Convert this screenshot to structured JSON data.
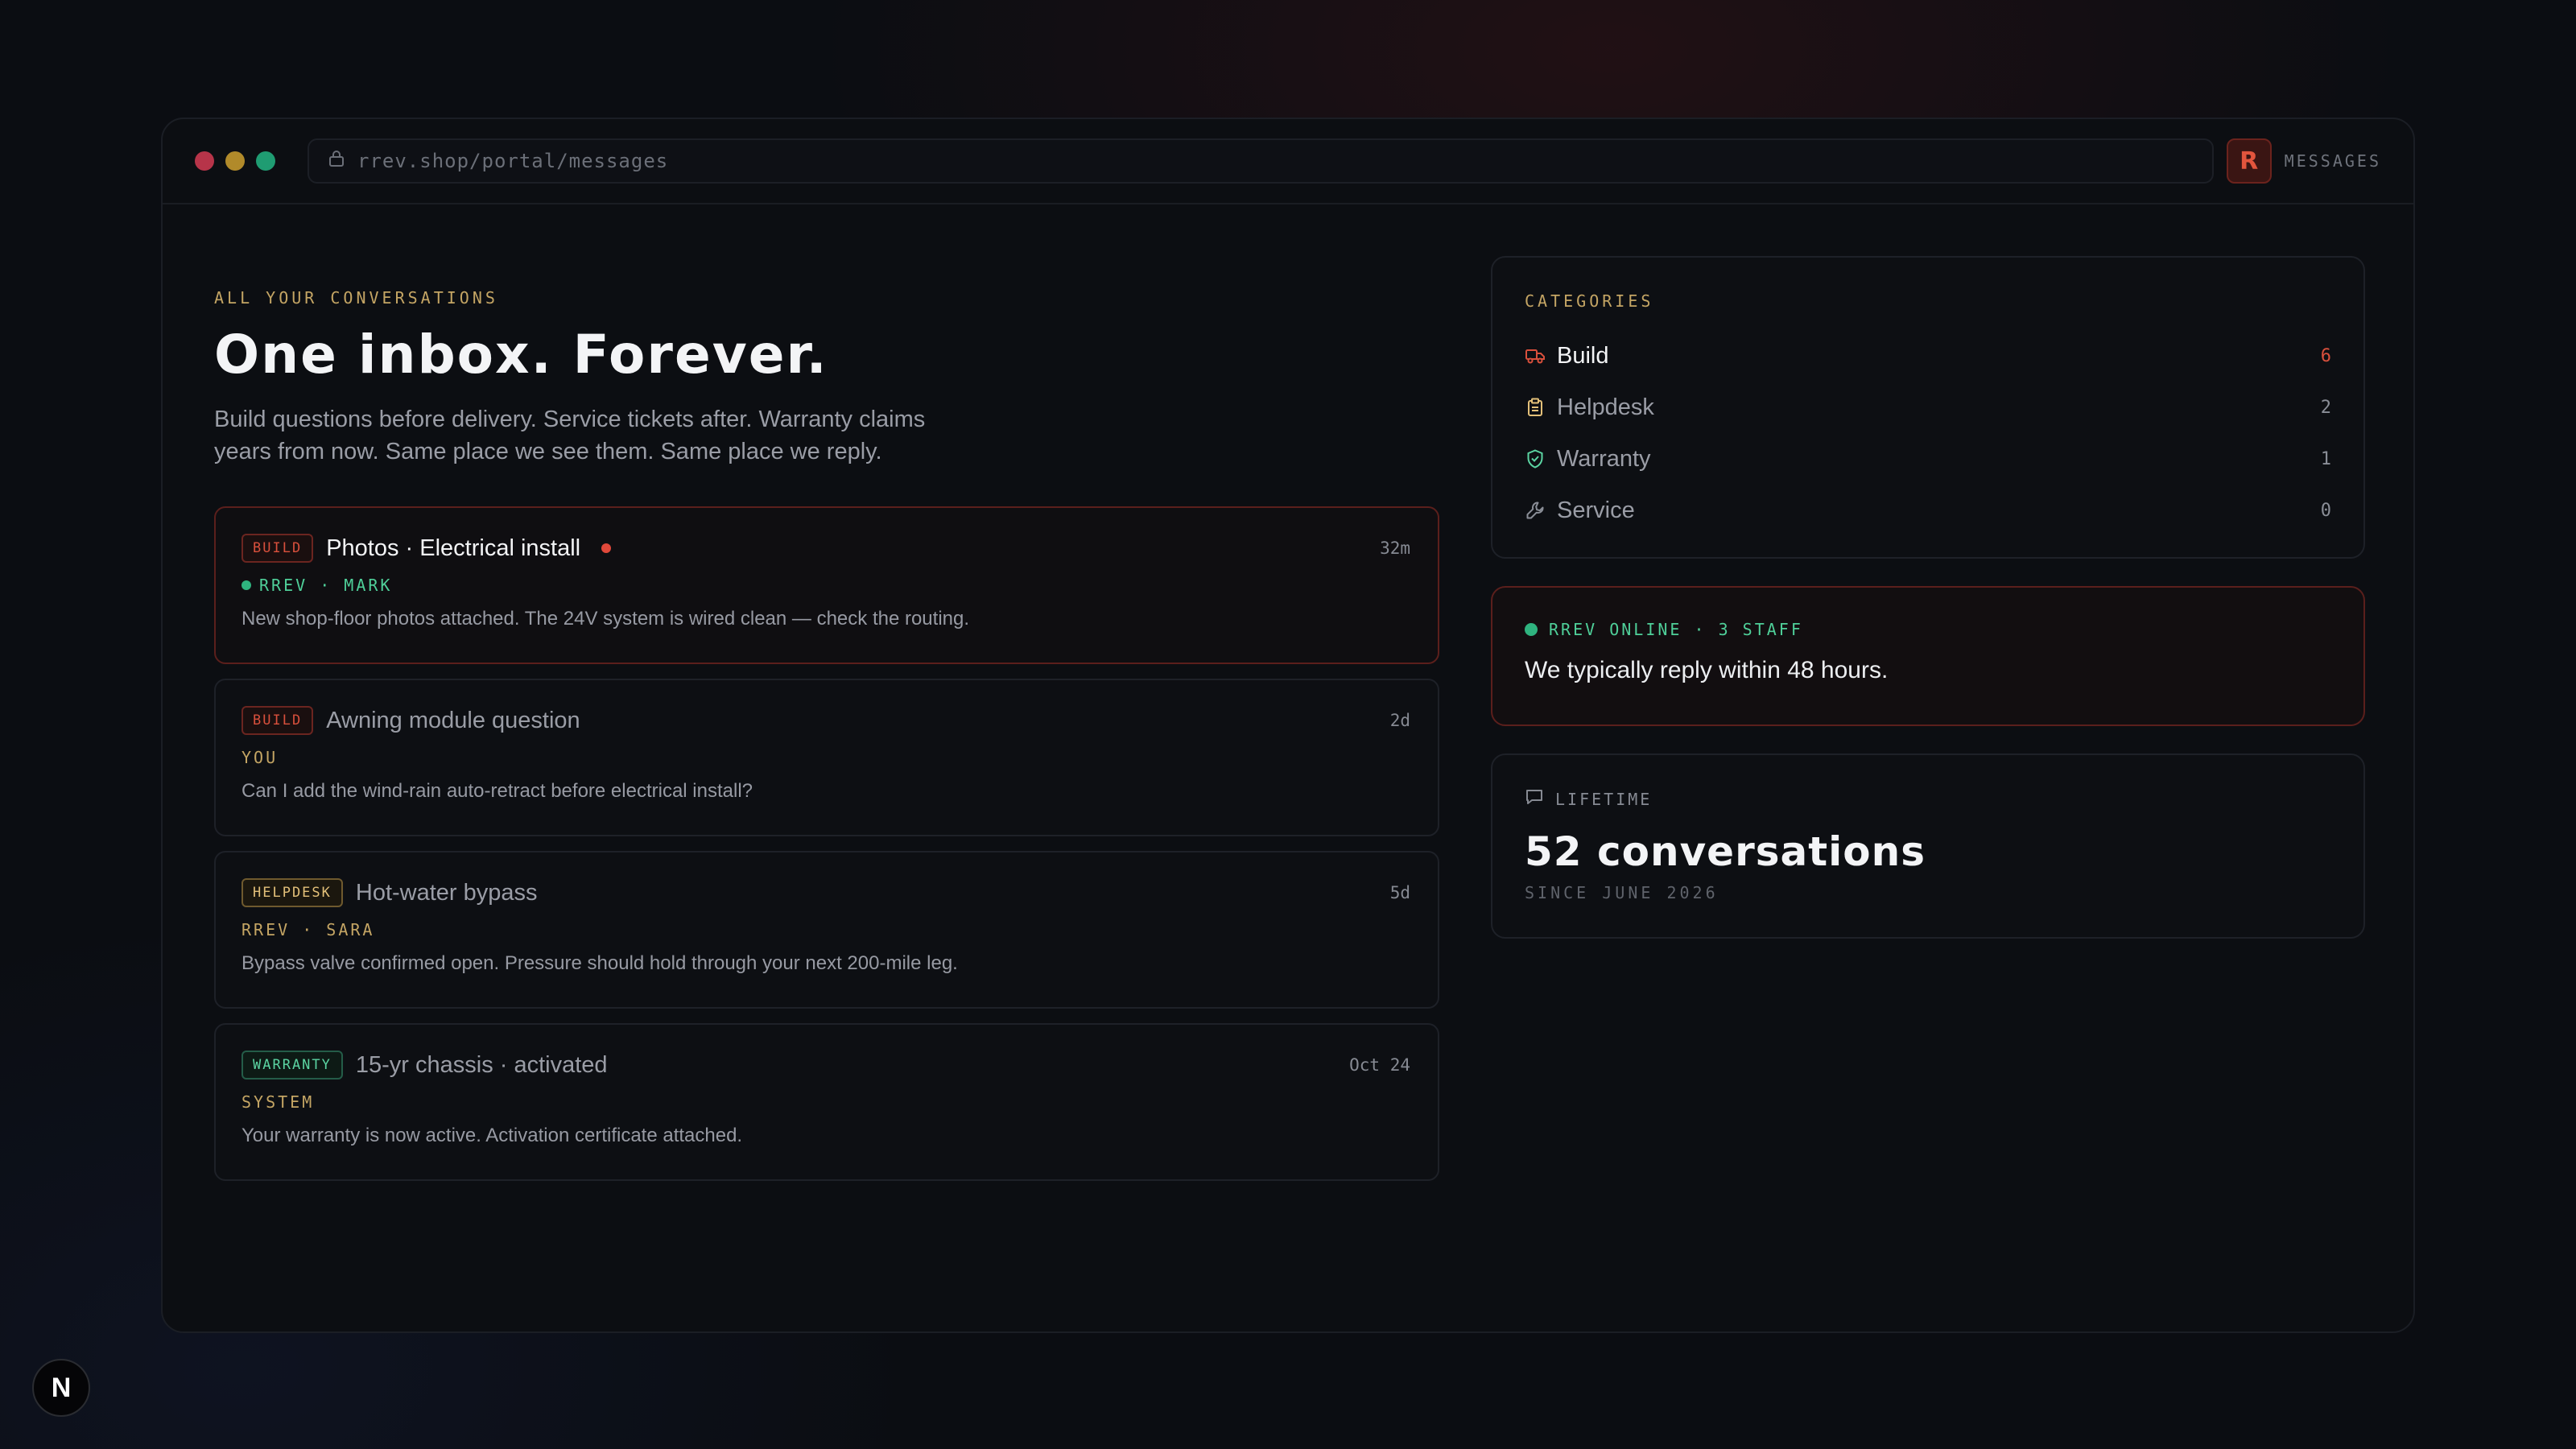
{
  "browser": {
    "url": "rrev.shop/portal/messages",
    "brand_letter": "R",
    "section_label": "MESSAGES",
    "dot_colors": [
      "#b73449",
      "#b18a2a",
      "#1f9c72"
    ]
  },
  "header": {
    "eyebrow": "ALL YOUR CONVERSATIONS",
    "title": "One inbox. Forever.",
    "lead": "Build questions before delivery. Service tickets after. Warranty claims years from now. Same place we see them. Same place we reply."
  },
  "conversations": [
    {
      "tag": "BUILD",
      "title": "Photos · Electrical install",
      "unread": true,
      "time": "32m",
      "meta": "RREV · MARK",
      "online": true,
      "body": "New shop-floor photos attached. The 24V system is wired clean — check the routing."
    },
    {
      "tag": "BUILD",
      "title": "Awning module question",
      "unread": false,
      "time": "2d",
      "meta": "YOU",
      "online": false,
      "body": "Can I add the wind-rain auto-retract before electrical install?"
    },
    {
      "tag": "HELPDESK",
      "title": "Hot-water bypass",
      "unread": false,
      "time": "5d",
      "meta": "RREV · SARA",
      "online": false,
      "body": "Bypass valve confirmed open. Pressure should hold through your next 200-mile leg."
    },
    {
      "tag": "WARRANTY",
      "title": "15-yr chassis · activated",
      "unread": false,
      "time": "Oct 24",
      "meta": "SYSTEM",
      "online": false,
      "body": "Your warranty is now active. Activation certificate attached."
    }
  ],
  "categories": {
    "title": "CATEGORIES",
    "items": [
      {
        "label": "Build",
        "count": "6",
        "icon": "truck-icon",
        "active": true
      },
      {
        "label": "Helpdesk",
        "count": "2",
        "icon": "clipboard-icon",
        "active": false
      },
      {
        "label": "Warranty",
        "count": "1",
        "icon": "shield-check-icon",
        "active": false
      },
      {
        "label": "Service",
        "count": "0",
        "icon": "wrench-icon",
        "active": false
      }
    ]
  },
  "status": {
    "label": "RREV ONLINE · 3 STAFF",
    "text": "We typically reply within 48 hours."
  },
  "stats": {
    "label": "LIFETIME",
    "value": "52 conversations",
    "since": "SINCE JUNE 2026"
  },
  "corner_badge": "N",
  "colors": {
    "accent_red": "#d9503c",
    "accent_gold": "#c4a564",
    "accent_green": "#2fb37f"
  }
}
